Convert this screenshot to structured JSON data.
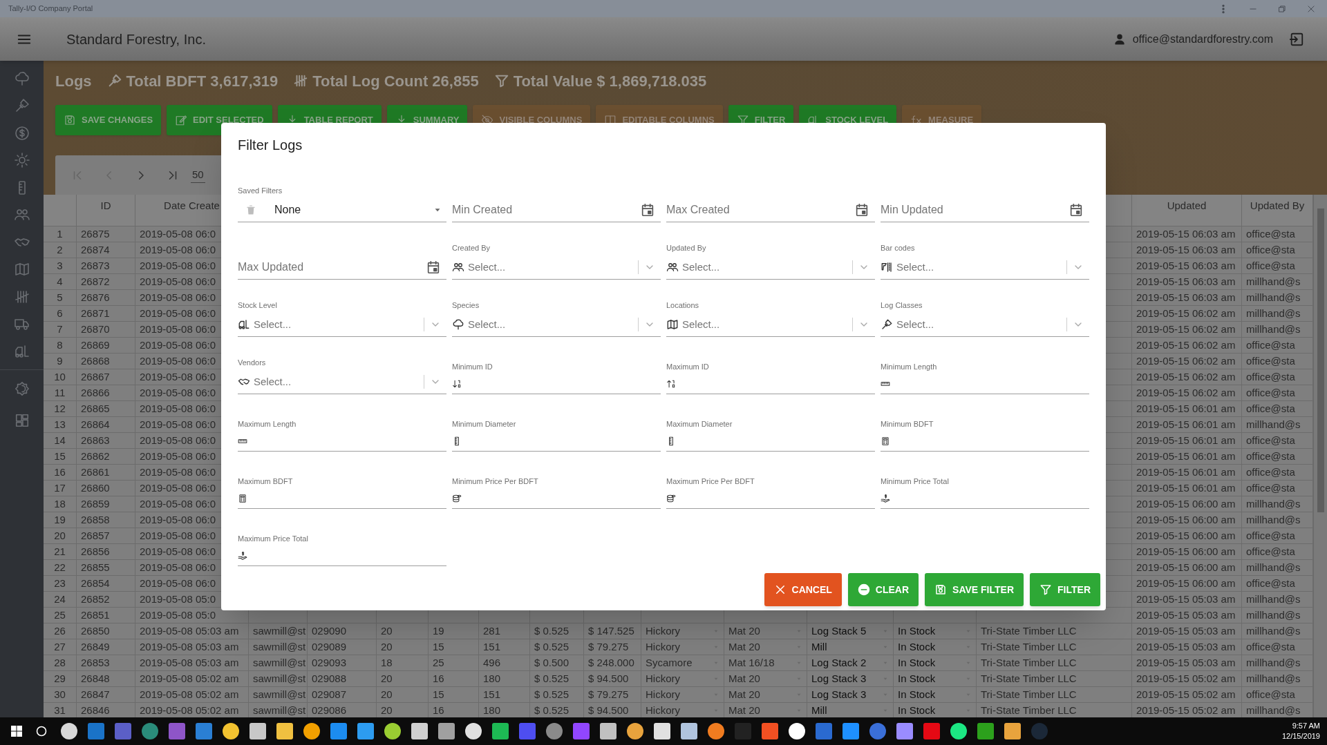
{
  "window": {
    "title": "Tally-I/O Company Portal"
  },
  "app_bar": {
    "company": "Standard Forestry, Inc.",
    "user": "office@standardforestry.com"
  },
  "summary": {
    "title": "Logs",
    "stats": [
      "Total BDFT 3,617,319",
      "Total Log Count 26,855",
      "Total Value $ 1,869,718.035"
    ]
  },
  "toolbar": [
    {
      "label": "SAVE CHANGES",
      "kind": "primary"
    },
    {
      "label": "EDIT SELECTED",
      "kind": "primary"
    },
    {
      "label": "TABLE REPORT",
      "kind": "primary"
    },
    {
      "label": "SUMMARY",
      "kind": "primary"
    },
    {
      "label": "VISIBLE COLUMNS",
      "kind": "secondary"
    },
    {
      "label": "EDITABLE COLUMNS",
      "kind": "secondary"
    },
    {
      "label": "FILTER",
      "kind": "primary"
    },
    {
      "label": "STOCK LEVEL",
      "kind": "primary"
    },
    {
      "label": "MEASURE",
      "kind": "secondary"
    }
  ],
  "pagination": {
    "page_size": "50"
  },
  "table": {
    "columns": [
      "ID",
      "Date Create",
      "Updated",
      "Updated By"
    ],
    "rows": [
      {
        "n": "1",
        "id": "26875",
        "date_created": "2019-05-08 06:0",
        "updated": "2019-05-15 06:03 am",
        "updated_by": "office@sta"
      },
      {
        "n": "2",
        "id": "26874",
        "date_created": "2019-05-08 06:0",
        "updated": "2019-05-15 06:03 am",
        "updated_by": "office@sta"
      },
      {
        "n": "3",
        "id": "26873",
        "date_created": "2019-05-08 06:0",
        "updated": "2019-05-15 06:03 am",
        "updated_by": "office@sta"
      },
      {
        "n": "4",
        "id": "26872",
        "date_created": "2019-05-08 06:0",
        "updated": "2019-05-15 06:03 am",
        "updated_by": "millhand@s"
      },
      {
        "n": "5",
        "id": "26876",
        "date_created": "2019-05-08 06:0",
        "updated": "2019-05-15 06:03 am",
        "updated_by": "millhand@s"
      },
      {
        "n": "6",
        "id": "26871",
        "date_created": "2019-05-08 06:0",
        "updated": "2019-05-15 06:02 am",
        "updated_by": "millhand@s"
      },
      {
        "n": "7",
        "id": "26870",
        "date_created": "2019-05-08 06:0",
        "updated": "2019-05-15 06:02 am",
        "updated_by": "millhand@s"
      },
      {
        "n": "8",
        "id": "26869",
        "date_created": "2019-05-08 06:0",
        "updated": "2019-05-15 06:02 am",
        "updated_by": "office@sta"
      },
      {
        "n": "9",
        "id": "26868",
        "date_created": "2019-05-08 06:0",
        "updated": "2019-05-15 06:02 am",
        "updated_by": "office@sta"
      },
      {
        "n": "10",
        "id": "26867",
        "date_created": "2019-05-08 06:0",
        "updated": "2019-05-15 06:02 am",
        "updated_by": "office@sta"
      },
      {
        "n": "11",
        "id": "26866",
        "date_created": "2019-05-08 06:0",
        "updated": "2019-05-15 06:02 am",
        "updated_by": "office@sta"
      },
      {
        "n": "12",
        "id": "26865",
        "date_created": "2019-05-08 06:0",
        "updated": "2019-05-15 06:01 am",
        "updated_by": "office@sta"
      },
      {
        "n": "13",
        "id": "26864",
        "date_created": "2019-05-08 06:0",
        "updated": "2019-05-15 06:01 am",
        "updated_by": "millhand@s"
      },
      {
        "n": "14",
        "id": "26863",
        "date_created": "2019-05-08 06:0",
        "updated": "2019-05-15 06:01 am",
        "updated_by": "office@sta"
      },
      {
        "n": "15",
        "id": "26862",
        "date_created": "2019-05-08 06:0",
        "updated": "2019-05-15 06:01 am",
        "updated_by": "office@sta"
      },
      {
        "n": "16",
        "id": "26861",
        "date_created": "2019-05-08 06:0",
        "updated": "2019-05-15 06:01 am",
        "updated_by": "office@sta"
      },
      {
        "n": "17",
        "id": "26860",
        "date_created": "2019-05-08 06:0",
        "updated": "2019-05-15 06:01 am",
        "updated_by": "office@sta"
      },
      {
        "n": "18",
        "id": "26859",
        "date_created": "2019-05-08 06:0",
        "updated": "2019-05-15 06:00 am",
        "updated_by": "millhand@s"
      },
      {
        "n": "19",
        "id": "26858",
        "date_created": "2019-05-08 06:0",
        "updated": "2019-05-15 06:00 am",
        "updated_by": "millhand@s"
      },
      {
        "n": "20",
        "id": "26857",
        "date_created": "2019-05-08 06:0",
        "updated": "2019-05-15 06:00 am",
        "updated_by": "office@sta"
      },
      {
        "n": "21",
        "id": "26856",
        "date_created": "2019-05-08 06:0",
        "updated": "2019-05-15 06:00 am",
        "updated_by": "office@sta"
      },
      {
        "n": "22",
        "id": "26855",
        "date_created": "2019-05-08 06:0",
        "updated": "2019-05-15 06:00 am",
        "updated_by": "millhand@s"
      },
      {
        "n": "23",
        "id": "26854",
        "date_created": "2019-05-08 06:0",
        "updated": "2019-05-15 06:00 am",
        "updated_by": "office@sta"
      },
      {
        "n": "24",
        "id": "26852",
        "date_created": "2019-05-08 05:0",
        "updated": "2019-05-15 05:03 am",
        "updated_by": "millhand@s"
      },
      {
        "n": "25",
        "id": "26851",
        "date_created": "2019-05-08 05:0",
        "updated": "2019-05-15 05:03 am",
        "updated_by": "millhand@s"
      },
      {
        "n": "26",
        "id": "26850",
        "date_created": "2019-05-08 05:03 am",
        "column_4": "sawmill@st",
        "column_5": "029090",
        "column_6": "20",
        "column_7": "19",
        "column_8": "281",
        "column_9": "$ 0.525",
        "column_10": "$ 147.525",
        "column_11": "Hickory",
        "column_12": "Mat 20",
        "column_13": "Log Stack 5",
        "column_14": "In Stock",
        "column_15": "Tri-State Timber LLC",
        "updated": "2019-05-15 05:03 am",
        "updated_by": "millhand@s"
      },
      {
        "n": "27",
        "id": "26849",
        "date_created": "2019-05-08 05:03 am",
        "column_4": "sawmill@st",
        "column_5": "029089",
        "column_6": "20",
        "column_7": "15",
        "column_8": "151",
        "column_9": "$ 0.525",
        "column_10": "$ 79.275",
        "column_11": "Hickory",
        "column_12": "Mat 20",
        "column_13": "Mill",
        "column_14": "In Stock",
        "column_15": "Tri-State Timber LLC",
        "updated": "2019-05-15 05:03 am",
        "updated_by": "office@sta"
      },
      {
        "n": "28",
        "id": "26853",
        "date_created": "2019-05-08 05:03 am",
        "column_4": "sawmill@st",
        "column_5": "029093",
        "column_6": "18",
        "column_7": "25",
        "column_8": "496",
        "column_9": "$ 0.500",
        "column_10": "$ 248.000",
        "column_11": "Sycamore",
        "column_12": "Mat 16/18",
        "column_13": "Log Stack 2",
        "column_14": "In Stock",
        "column_15": "Tri-State Timber LLC",
        "updated": "2019-05-15 05:03 am",
        "updated_by": "millhand@s"
      },
      {
        "n": "29",
        "id": "26848",
        "date_created": "2019-05-08 05:02 am",
        "column_4": "sawmill@st",
        "column_5": "029088",
        "column_6": "20",
        "column_7": "16",
        "column_8": "180",
        "column_9": "$ 0.525",
        "column_10": "$ 94.500",
        "column_11": "Hickory",
        "column_12": "Mat 20",
        "column_13": "Log Stack 3",
        "column_14": "In Stock",
        "column_15": "Tri-State Timber LLC",
        "updated": "2019-05-15 05:02 am",
        "updated_by": "millhand@s"
      },
      {
        "n": "30",
        "id": "26847",
        "date_created": "2019-05-08 05:02 am",
        "column_4": "sawmill@st",
        "column_5": "029087",
        "column_6": "20",
        "column_7": "15",
        "column_8": "151",
        "column_9": "$ 0.525",
        "column_10": "$ 79.275",
        "column_11": "Hickory",
        "column_12": "Mat 20",
        "column_13": "Log Stack 3",
        "column_14": "In Stock",
        "column_15": "Tri-State Timber LLC",
        "updated": "2019-05-15 05:02 am",
        "updated_by": "office@sta"
      },
      {
        "n": "31",
        "id": "26846",
        "date_created": "2019-05-08 05:02 am",
        "column_4": "sawmill@st",
        "column_5": "029086",
        "column_6": "20",
        "column_7": "16",
        "column_8": "180",
        "column_9": "$ 0.525",
        "column_10": "$ 94.500",
        "column_11": "Hickory",
        "column_12": "Mat 20",
        "column_13": "Mill",
        "column_14": "In Stock",
        "column_15": "Tri-State Timber LLC",
        "updated": "2019-05-15 05:02 am",
        "updated_by": "millhand@s"
      }
    ]
  },
  "filter_dialog": {
    "title": "Filter Logs",
    "fields": [
      {
        "kind": "saved",
        "label": "Saved Filters",
        "value": "None"
      },
      {
        "kind": "date",
        "placeholder": "Min Created"
      },
      {
        "kind": "date",
        "placeholder": "Max Created"
      },
      {
        "kind": "date",
        "placeholder": "Min Updated"
      },
      {
        "kind": "date",
        "placeholder": "Max Updated"
      },
      {
        "kind": "select",
        "label": "Created By",
        "placeholder": "Select..."
      },
      {
        "kind": "select",
        "label": "Updated By",
        "placeholder": "Select..."
      },
      {
        "kind": "select",
        "label": "Bar codes",
        "placeholder": "Select..."
      },
      {
        "kind": "select",
        "label": "Stock Level",
        "placeholder": "Select..."
      },
      {
        "kind": "select",
        "label": "Species",
        "placeholder": "Select..."
      },
      {
        "kind": "select",
        "label": "Locations",
        "placeholder": "Select..."
      },
      {
        "kind": "select",
        "label": "Log Classes",
        "placeholder": "Select..."
      },
      {
        "kind": "select",
        "label": "Vendors",
        "placeholder": "Select..."
      },
      {
        "kind": "number",
        "label": "Minimum ID"
      },
      {
        "kind": "number",
        "label": "Maximum ID"
      },
      {
        "kind": "number",
        "label": "Minimum Length"
      },
      {
        "kind": "number",
        "label": "Maximum Length"
      },
      {
        "kind": "number",
        "label": "Minimum Diameter"
      },
      {
        "kind": "number",
        "label": "Maximum Diameter"
      },
      {
        "kind": "number",
        "label": "Minimum BDFT"
      },
      {
        "kind": "number",
        "label": "Maximum BDFT"
      },
      {
        "kind": "number",
        "label": "Minimum Price Per BDFT"
      },
      {
        "kind": "number",
        "label": "Maximum Price Per BDFT"
      },
      {
        "kind": "number",
        "label": "Minimum Price Total"
      },
      {
        "kind": "number",
        "label": "Maximum Price Total"
      }
    ],
    "buttons": [
      {
        "label": "CANCEL",
        "kind": "cancel"
      },
      {
        "label": "CLEAR",
        "kind": "clear"
      },
      {
        "label": "SAVE FILTER",
        "kind": "save"
      },
      {
        "label": "FILTER",
        "kind": "filter"
      }
    ]
  },
  "taskbar": {
    "time": "9:57 AM",
    "date": "12/15/2019"
  }
}
